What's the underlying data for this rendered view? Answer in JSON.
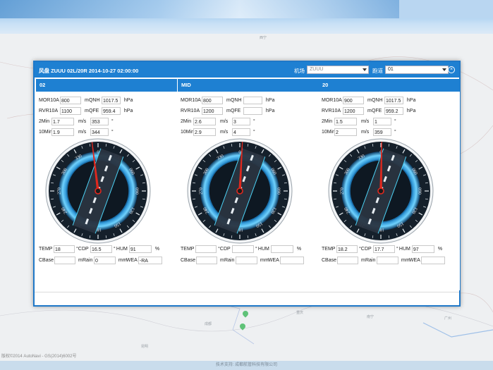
{
  "dialog": {
    "title": "风盘 ZUUU 02L/20R 2014-10-27 02:00:00",
    "airport_label": "机场",
    "airport_value": "ZUUU",
    "runway_label": "跑道",
    "runway_value": "01",
    "close_icon": "close-circle-icon"
  },
  "labels": {
    "mor": "MOR10A",
    "m": "m",
    "qnh": "QNH",
    "hpa": "hPa",
    "rvr": "RVR10A",
    "qfe": "QFE",
    "min2": "2Min",
    "min10": "10Min",
    "ms": "m/s",
    "deg": "°",
    "temp": "TEMP",
    "c": "°C",
    "dp": "DP",
    "hum": "HUM",
    "pct": "%",
    "cbase": "CBase",
    "rain": "Rain",
    "mm": "mm",
    "wea": "WEA"
  },
  "panels": [
    {
      "name": "02",
      "mor": "800",
      "qnh": "1017.5",
      "rvr": "1100",
      "qfe": "959.4",
      "ws2": "1.7",
      "wd2": "353",
      "ws10": "1.9",
      "wd10": "344",
      "temp": "18",
      "dp": "16.5",
      "hum": "91",
      "cbase": "",
      "rain": "0",
      "wea": "-RA",
      "needle_deg": 353,
      "runway_deg": 20
    },
    {
      "name": "MID",
      "mor": "800",
      "qnh": "",
      "rvr": "1200",
      "qfe": "",
      "ws2": "2.6",
      "wd2": "3",
      "ws10": "2.9",
      "wd10": "4",
      "temp": "",
      "dp": "",
      "hum": "",
      "cbase": "",
      "rain": "",
      "wea": "",
      "needle_deg": 3,
      "runway_deg": 20
    },
    {
      "name": "20",
      "mor": "900",
      "qnh": "1017.5",
      "rvr": "1200",
      "qfe": "959.2",
      "ws2": "1.5",
      "wd2": "1",
      "ws10": "2",
      "wd10": "359",
      "temp": "18.2",
      "dp": "17.7",
      "hum": "97",
      "cbase": "",
      "rain": "",
      "wea": "",
      "needle_deg": 1,
      "runway_deg": 20
    }
  ],
  "compass_ticks": [
    "0",
    "030",
    "060",
    "090",
    "120",
    "150",
    "180",
    "210",
    "240",
    "270",
    "300",
    "330"
  ],
  "colors": {
    "accent": "#1e80d2",
    "needle": "#e0281e",
    "ring": "#2fa8e6"
  },
  "map": {
    "copyright": "版权©2014 AutoNavi - GS(2014)6002号",
    "labels": [
      "西宁",
      "成都",
      "重庆",
      "昆明",
      "南宁",
      "广州"
    ]
  },
  "footer": {
    "text": "技术支持: 成都航管科技有限公司"
  }
}
